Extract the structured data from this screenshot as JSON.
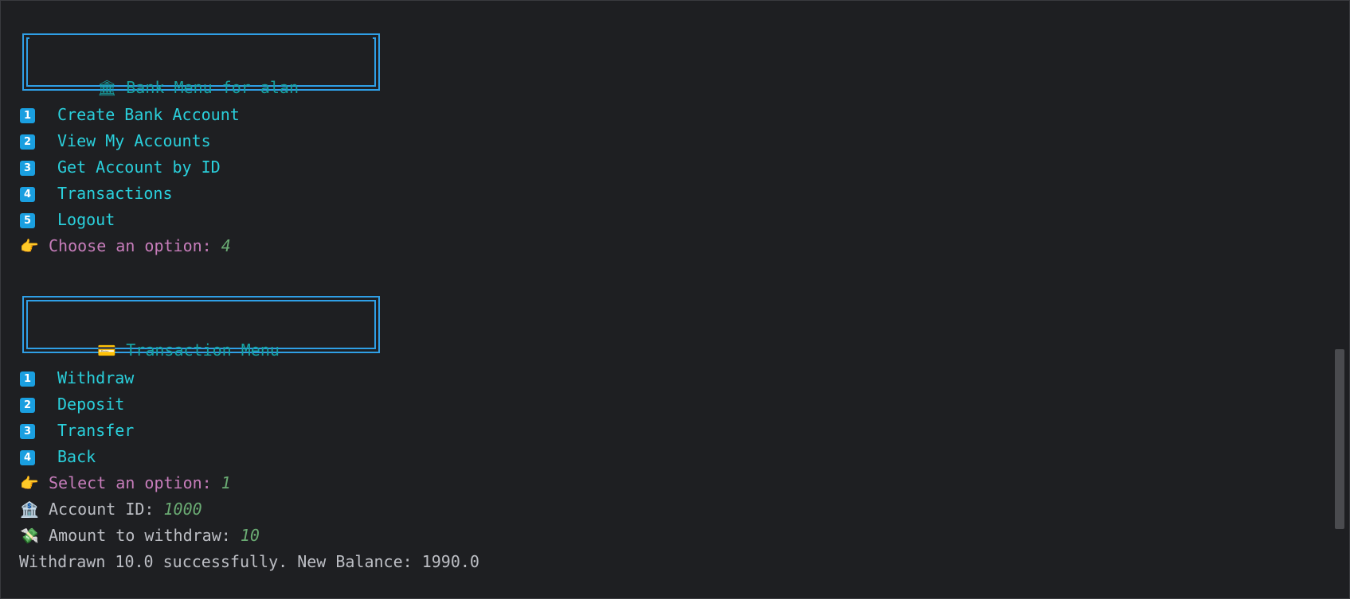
{
  "bank_menu": {
    "icon": "bank-icon",
    "title": "Bank Menu for alan",
    "items": [
      {
        "num": "1",
        "label": "Create Bank Account"
      },
      {
        "num": "2",
        "label": "View My Accounts"
      },
      {
        "num": "3",
        "label": "Get Account by ID"
      },
      {
        "num": "4",
        "label": "Transactions"
      },
      {
        "num": "5",
        "label": "Logout"
      }
    ],
    "prompt": "Choose an option: ",
    "input": "4"
  },
  "transaction_menu": {
    "icon": "credit-card-icon",
    "title": "Transaction Menu",
    "items": [
      {
        "num": "1",
        "label": "Withdraw"
      },
      {
        "num": "2",
        "label": "Deposit"
      },
      {
        "num": "3",
        "label": "Transfer"
      },
      {
        "num": "4",
        "label": "Back"
      }
    ],
    "prompt": "Select an option: ",
    "input": "1"
  },
  "account_id": {
    "label": "Account ID: ",
    "value": "1000"
  },
  "amount": {
    "label": "Amount to withdraw: ",
    "value": "10"
  },
  "result": "Withdrawn 10.0 successfully. New Balance: 1990.0",
  "colors": {
    "background": "#1e1f22",
    "menu_item": "#2ad0dc",
    "title": "#17a2a2",
    "prompt": "#c77dbb",
    "input": "#6aab73",
    "badge": "#1a9fe0",
    "border": "#2f9fe6"
  }
}
